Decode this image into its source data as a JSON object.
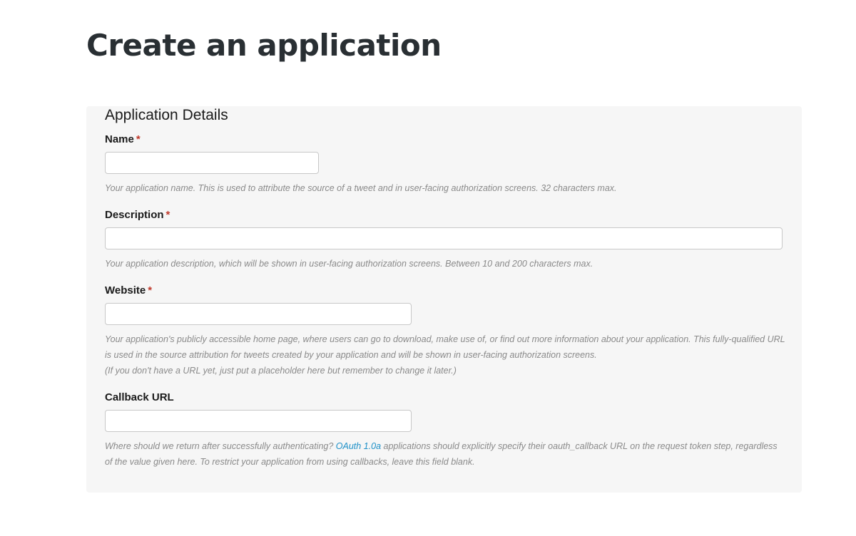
{
  "page": {
    "title": "Create an application"
  },
  "form": {
    "section_heading": "Application Details",
    "required_mark": "*",
    "name": {
      "label": "Name",
      "value": "",
      "help": "Your application name. This is used to attribute the source of a tweet and in user-facing authorization screens. 32 characters max."
    },
    "description": {
      "label": "Description",
      "value": "",
      "help": "Your application description, which will be shown in user-facing authorization screens. Between 10 and 200 characters max."
    },
    "website": {
      "label": "Website",
      "value": "",
      "help_line1": "Your application's publicly accessible home page, where users can go to download, make use of, or find out more information about your application. This fully-qualified URL is used in the source attribution for tweets created by your application and will be shown in user-facing authorization screens.",
      "help_line2": "(If you don't have a URL yet, just put a placeholder here but remember to change it later.)"
    },
    "callback_url": {
      "label": "Callback URL",
      "value": "",
      "help_before_link": "Where should we return after successfully authenticating? ",
      "help_link": "OAuth 1.0a",
      "help_after_link": " applications should explicitly specify their oauth_callback URL on the request token step, regardless of the value given here. To restrict your application from using callbacks, leave this field blank."
    }
  },
  "colors": {
    "required": "#c0392b",
    "link": "#1b8fc7",
    "panel_background": "#f6f6f6",
    "help_text": "#8a8a8a"
  }
}
